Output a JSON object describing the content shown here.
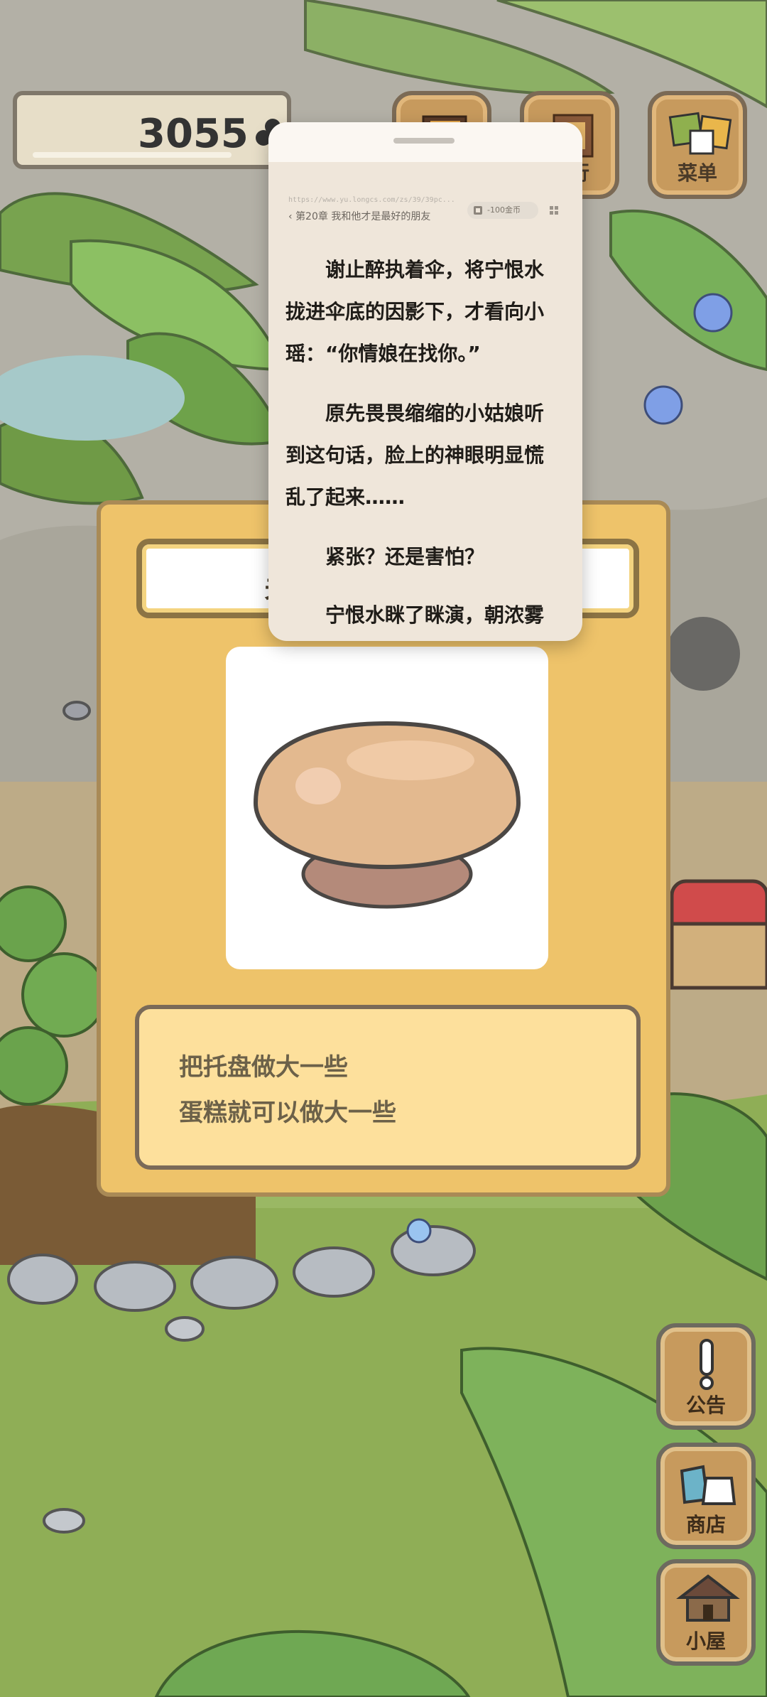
{
  "score": {
    "value": "3055"
  },
  "top_buttons": [
    {
      "label": "",
      "partial": true
    },
    {
      "label": "旅行",
      "partial": true
    },
    {
      "label": "菜单"
    }
  ],
  "card": {
    "title_fragment": "关",
    "description": [
      "把托盘做大一些",
      "蛋糕就可以做大一些"
    ]
  },
  "side_buttons": [
    {
      "label": "公告"
    },
    {
      "label": "商店"
    },
    {
      "label": "小屋"
    }
  ],
  "reader": {
    "url": "https://www.yu.longcs.com/zs/39/39pc...",
    "chapter": "第20章 我和他才是最好的朋友",
    "coin": "-100金币",
    "paragraphs": [
      [
        "　　谢止醉执着伞，将宁恨水",
        "拢进伞底的因影下，才看向小",
        "瑶：“你情娘在找你。”"
      ],
      [
        "　　原先畏畏缩缩的小姑娘听",
        "到这句话，脸上的神眼明显慌",
        "乱了起来……"
      ],
      [
        "　　紧张？还是害怕？"
      ],
      [
        "　　宁恨水眯了眯演，朝浓雾"
      ]
    ]
  },
  "colors": {
    "card_bg": "#eec36a",
    "reader_bg": "#efe6da",
    "wood": "#c79a5d",
    "grass": "#8fae56"
  }
}
